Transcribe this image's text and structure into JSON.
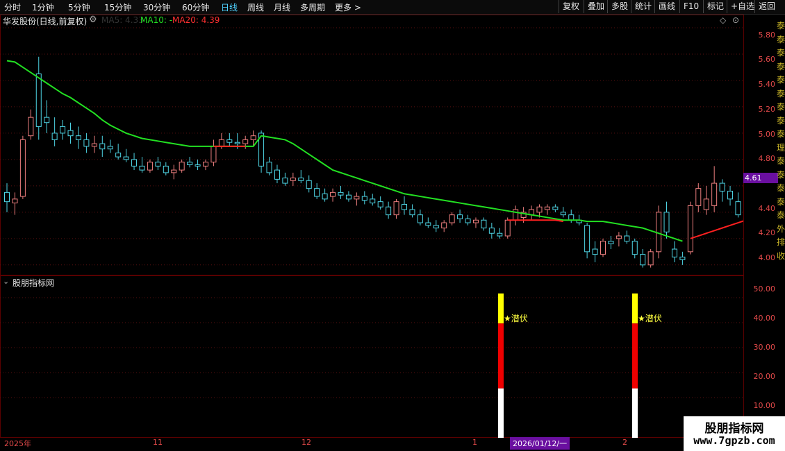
{
  "toolbar": {
    "periods": [
      "分时",
      "1分钟",
      "5分钟",
      "15分钟",
      "30分钟",
      "60分钟",
      "日线",
      "周线",
      "月线",
      "多周期",
      "更多 >"
    ],
    "active_period": "日线",
    "tools": [
      "复权",
      "叠加",
      "多股",
      "统计",
      "画线",
      "F10",
      "标记",
      "+自选",
      "返回"
    ]
  },
  "infobar": {
    "title": "华发股份(日线,前复权)",
    "ma5_label": "MA5: 4.33",
    "ma10_label": "MA10: -",
    "ma20_label": "MA20: 4.39"
  },
  "price_axis": {
    "ticks": [
      "5.80",
      "5.60",
      "5.40",
      "5.20",
      "5.00",
      "4.80",
      "4.60",
      "4.40",
      "4.20",
      "4.00"
    ],
    "current_price": "4.61"
  },
  "indicator": {
    "title": "股朋指标网",
    "ticks": [
      "50.00",
      "40.00",
      "30.00",
      "20.00",
      "10.00"
    ],
    "signal_label": "★潜伏",
    "signals": [
      {
        "date_index": 0,
        "white_top": 12,
        "red_top": 38,
        "yellow_top": 50
      },
      {
        "date_index": 1,
        "white_top": 12,
        "red_top": 38,
        "yellow_top": 50
      }
    ]
  },
  "xaxis": {
    "labels": [
      "2025年",
      "11",
      "12",
      "1",
      "2"
    ],
    "cursor_date": "2026/01/12/一"
  },
  "right_edge_chars": [
    "泰",
    "泰",
    "泰",
    "泰",
    "泰",
    "泰",
    "泰",
    "泰",
    "泰",
    "理",
    "泰",
    "泰",
    "泰",
    "泰",
    "泰",
    "外",
    "排",
    "收"
  ],
  "watermark": {
    "line1": "股朋指标网",
    "line2": "www.7gpzb.com"
  },
  "colors": {
    "up": "#f08080",
    "down": "#4fd6e6",
    "ma_green": "#22e022",
    "ma_red": "#ff2020",
    "axis_red": "#e34a4a",
    "bar_yellow": "#ffff00",
    "bar_red": "#ee0000",
    "bar_white": "#ffffff",
    "signal_text": "#ffff40",
    "purple_badge": "#6a0fa0"
  },
  "chart_data": {
    "type": "candlestick",
    "ylim": [
      3.92,
      5.9
    ],
    "candles": [
      [
        4.55,
        4.62,
        4.4,
        4.48
      ],
      [
        4.47,
        4.55,
        4.38,
        4.5
      ],
      [
        4.52,
        4.98,
        4.5,
        4.95
      ],
      [
        4.98,
        5.18,
        4.95,
        5.12
      ],
      [
        5.45,
        5.58,
        4.95,
        5.05
      ],
      [
        5.12,
        5.25,
        5.0,
        5.08
      ],
      [
        5.0,
        5.12,
        4.9,
        4.95
      ],
      [
        5.05,
        5.1,
        4.95,
        5.0
      ],
      [
        5.02,
        5.08,
        4.92,
        4.98
      ],
      [
        4.98,
        5.05,
        4.88,
        4.95
      ],
      [
        4.95,
        5.0,
        4.85,
        4.9
      ],
      [
        4.9,
        4.98,
        4.85,
        4.92
      ],
      [
        4.92,
        4.98,
        4.82,
        4.88
      ],
      [
        4.9,
        4.95,
        4.85,
        4.88
      ],
      [
        4.85,
        4.92,
        4.8,
        4.82
      ],
      [
        4.82,
        4.88,
        4.78,
        4.8
      ],
      [
        4.8,
        4.85,
        4.72,
        4.75
      ],
      [
        4.75,
        4.82,
        4.7,
        4.72
      ],
      [
        4.72,
        4.8,
        4.7,
        4.78
      ],
      [
        4.78,
        4.82,
        4.72,
        4.75
      ],
      [
        4.75,
        4.78,
        4.68,
        4.7
      ],
      [
        4.7,
        4.76,
        4.65,
        4.72
      ],
      [
        4.72,
        4.8,
        4.7,
        4.78
      ],
      [
        4.78,
        4.82,
        4.74,
        4.76
      ],
      [
        4.76,
        4.8,
        4.72,
        4.75
      ],
      [
        4.75,
        4.8,
        4.72,
        4.78
      ],
      [
        4.78,
        4.95,
        4.75,
        4.9
      ],
      [
        4.9,
        5.0,
        4.88,
        4.95
      ],
      [
        4.95,
        5.0,
        4.9,
        4.93
      ],
      [
        4.93,
        5.0,
        4.88,
        4.92
      ],
      [
        4.92,
        4.98,
        4.88,
        4.95
      ],
      [
        4.95,
        5.02,
        4.9,
        4.98
      ],
      [
        5.0,
        5.02,
        4.7,
        4.75
      ],
      [
        4.78,
        4.82,
        4.68,
        4.7
      ],
      [
        4.72,
        4.76,
        4.62,
        4.65
      ],
      [
        4.66,
        4.7,
        4.6,
        4.62
      ],
      [
        4.64,
        4.7,
        4.6,
        4.66
      ],
      [
        4.66,
        4.72,
        4.62,
        4.64
      ],
      [
        4.64,
        4.68,
        4.55,
        4.58
      ],
      [
        4.58,
        4.62,
        4.5,
        4.52
      ],
      [
        4.54,
        4.58,
        4.48,
        4.5
      ],
      [
        4.52,
        4.58,
        4.48,
        4.55
      ],
      [
        4.55,
        4.6,
        4.5,
        4.53
      ],
      [
        4.53,
        4.56,
        4.48,
        4.5
      ],
      [
        4.5,
        4.55,
        4.45,
        4.52
      ],
      [
        4.52,
        4.56,
        4.46,
        4.49
      ],
      [
        4.5,
        4.54,
        4.45,
        4.47
      ],
      [
        4.48,
        4.52,
        4.42,
        4.44
      ],
      [
        4.44,
        4.48,
        4.35,
        4.38
      ],
      [
        4.38,
        4.5,
        4.35,
        4.48
      ],
      [
        4.46,
        4.52,
        4.38,
        4.42
      ],
      [
        4.42,
        4.46,
        4.36,
        4.38
      ],
      [
        4.38,
        4.42,
        4.3,
        4.32
      ],
      [
        4.32,
        4.36,
        4.28,
        4.3
      ],
      [
        4.3,
        4.34,
        4.25,
        4.28
      ],
      [
        4.28,
        4.34,
        4.25,
        4.32
      ],
      [
        4.32,
        4.4,
        4.3,
        4.38
      ],
      [
        4.38,
        4.42,
        4.32,
        4.35
      ],
      [
        4.35,
        4.38,
        4.3,
        4.32
      ],
      [
        4.32,
        4.36,
        4.28,
        4.34
      ],
      [
        4.34,
        4.36,
        4.26,
        4.28
      ],
      [
        4.28,
        4.32,
        4.2,
        4.24
      ],
      [
        4.24,
        4.28,
        4.2,
        4.22
      ],
      [
        4.22,
        4.36,
        4.2,
        4.34
      ],
      [
        4.34,
        4.45,
        4.3,
        4.42
      ],
      [
        4.36,
        4.44,
        4.32,
        4.4
      ],
      [
        4.38,
        4.45,
        4.34,
        4.42
      ],
      [
        4.4,
        4.46,
        4.36,
        4.44
      ],
      [
        4.42,
        4.46,
        4.38,
        4.44
      ],
      [
        4.44,
        4.46,
        4.4,
        4.42
      ],
      [
        4.4,
        4.44,
        4.36,
        4.38
      ],
      [
        4.38,
        4.42,
        4.32,
        4.34
      ],
      [
        4.34,
        4.38,
        4.3,
        4.32
      ],
      [
        4.3,
        4.32,
        4.05,
        4.1
      ],
      [
        4.12,
        4.18,
        4.02,
        4.08
      ],
      [
        4.08,
        4.2,
        4.06,
        4.18
      ],
      [
        4.18,
        4.22,
        4.12,
        4.16
      ],
      [
        4.2,
        4.25,
        4.14,
        4.22
      ],
      [
        4.22,
        4.26,
        4.16,
        4.18
      ],
      [
        4.18,
        4.2,
        4.05,
        4.08
      ],
      [
        4.08,
        4.12,
        3.98,
        4.0
      ],
      [
        4.0,
        4.12,
        3.98,
        4.1
      ],
      [
        4.1,
        4.45,
        4.05,
        4.4
      ],
      [
        4.4,
        4.48,
        4.2,
        4.25
      ],
      [
        4.12,
        4.18,
        4.02,
        4.06
      ],
      [
        4.06,
        4.1,
        4.0,
        4.04
      ],
      [
        4.1,
        4.48,
        4.08,
        4.45
      ],
      [
        4.45,
        4.62,
        4.4,
        4.58
      ],
      [
        4.42,
        4.6,
        4.38,
        4.5
      ],
      [
        4.45,
        4.75,
        4.4,
        4.62
      ],
      [
        4.62,
        4.65,
        4.48,
        4.56
      ],
      [
        4.56,
        4.6,
        4.45,
        4.5
      ],
      [
        4.48,
        4.55,
        4.36,
        4.38
      ],
      [
        4.3,
        4.4,
        4.25,
        4.35
      ],
      [
        4.28,
        4.45,
        4.26,
        4.4
      ],
      [
        4.4,
        4.6,
        4.35,
        4.5
      ],
      [
        4.5,
        4.55,
        4.28,
        4.32
      ],
      [
        4.32,
        4.38,
        4.25,
        4.3
      ]
    ],
    "ma_green": [
      5.55,
      5.54,
      5.5,
      5.46,
      5.42,
      5.38,
      5.34,
      5.3,
      5.27,
      5.23,
      5.19,
      5.15,
      5.1,
      5.06,
      5.03,
      5.0,
      4.98,
      4.96,
      4.95,
      4.94,
      4.93,
      4.92,
      4.91,
      4.9,
      4.9,
      4.9,
      4.9,
      4.9,
      4.9,
      4.9,
      4.9,
      4.9,
      4.98,
      4.97,
      4.96,
      4.95,
      4.92,
      4.88,
      4.84,
      4.8,
      4.76,
      4.72,
      4.7,
      4.68,
      4.66,
      4.64,
      4.62,
      4.6,
      4.58,
      4.56,
      4.54,
      4.53,
      4.52,
      4.51,
      4.5,
      4.49,
      4.48,
      4.47,
      4.46,
      4.45,
      4.44,
      4.43,
      4.42,
      4.41,
      4.4,
      4.39,
      4.38,
      4.37,
      4.36,
      4.35,
      4.34,
      4.34,
      4.34,
      4.33,
      4.33,
      4.33,
      4.32,
      4.31,
      4.3,
      4.29,
      4.28,
      4.26,
      4.24,
      4.22,
      4.2,
      4.18
    ],
    "ma_red_segments": [
      {
        "start": 26,
        "values": [
          4.9,
          4.9,
          4.9,
          4.9,
          4.9
        ]
      },
      {
        "start": 63,
        "values": [
          4.34,
          4.34,
          4.34,
          4.34,
          4.34,
          4.34,
          4.34,
          4.33
        ]
      },
      {
        "start": 86,
        "values": [
          4.2,
          4.22,
          4.24,
          4.26,
          4.28,
          4.3,
          4.32,
          4.34,
          4.36,
          4.37,
          4.38,
          4.4
        ]
      }
    ]
  }
}
